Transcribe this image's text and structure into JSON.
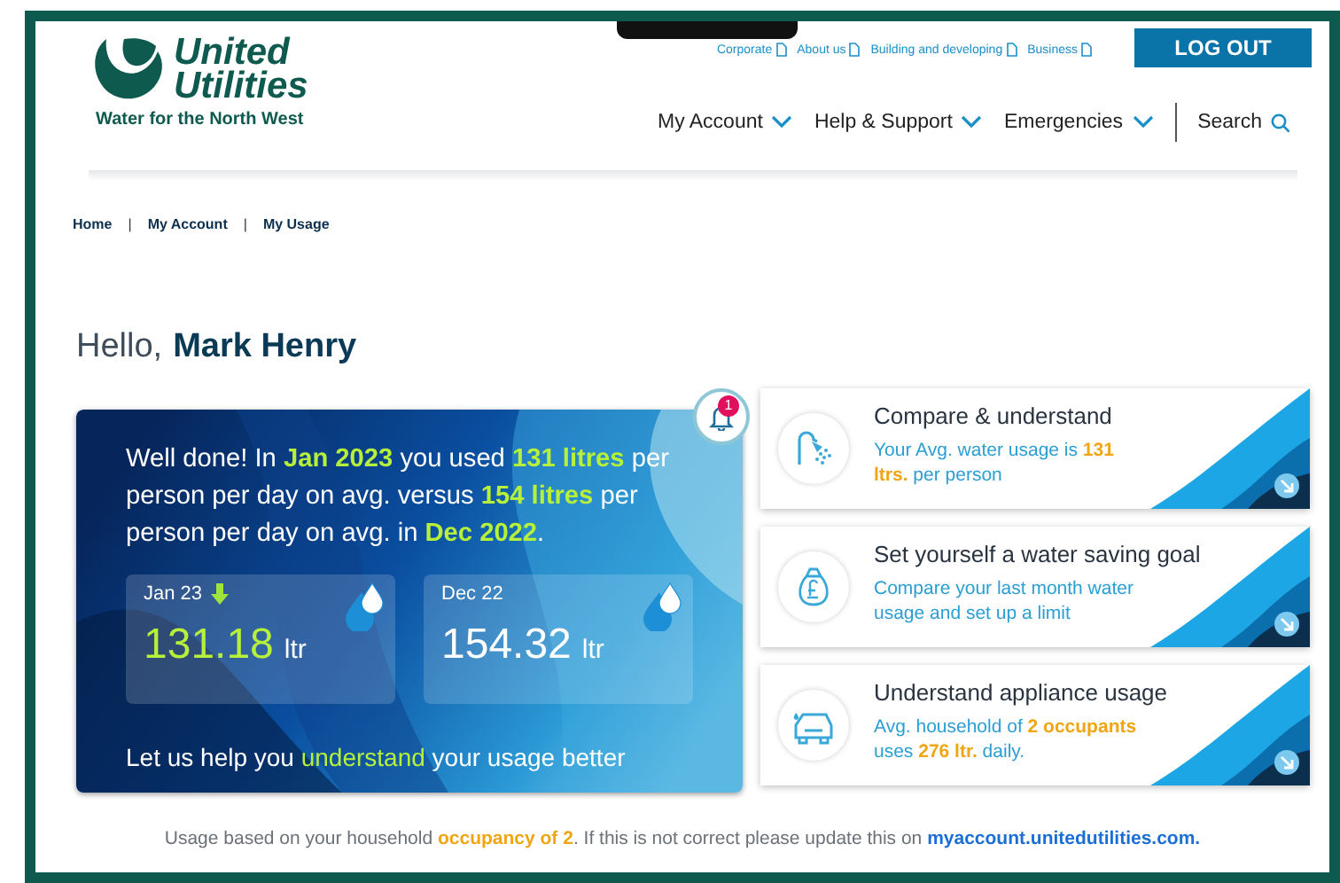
{
  "header": {
    "logo_name": "United Utilities",
    "tagline": "Water for the North West",
    "top_links": [
      "Corporate",
      "About us",
      "Building and developing",
      "Business"
    ],
    "logout": "LOG OUT",
    "nav": [
      {
        "label": "My Account",
        "kind": "dropdown"
      },
      {
        "label": "Help & Support",
        "kind": "dropdown"
      },
      {
        "label": "Emergencies",
        "kind": "dropdown"
      },
      {
        "label": "Search",
        "kind": "search"
      }
    ]
  },
  "breadcrumb": [
    {
      "label": "Home",
      "kind": "link"
    },
    {
      "label": "|",
      "kind": "separator"
    },
    {
      "label": "My Account",
      "kind": "link"
    },
    {
      "label": "|",
      "kind": "separator"
    },
    {
      "label": "My Usage",
      "kind": "link"
    }
  ],
  "greeting": {
    "prefix": "Hello,",
    "name": "Mark Henry"
  },
  "usage_card": {
    "summary": "Well done! In **Jan 2023** you used **131 litres** per person per day on avg. versus **154 litres** per person per day on avg. in **Dec 2022**.",
    "notifications": "1",
    "tiles": [
      {
        "label": "Jan 23",
        "kind": "decrease",
        "value": "131.18",
        "unit": "ltr",
        "highlight": true
      },
      {
        "label": "Dec 22",
        "kind": "plain",
        "value": "154.32",
        "unit": "ltr",
        "highlight": false
      }
    ],
    "footer": "Let us help you **understand** your usage better"
  },
  "cards": [
    {
      "kind": "shower",
      "title": "Compare & understand",
      "text": "Your Avg. water usage is **131 ltrs.** per person"
    },
    {
      "kind": "money-bag",
      "title": "Set yourself a water saving goal",
      "text": "Compare your last month water usage and set up a limit"
    },
    {
      "kind": "car",
      "title": "Understand appliance usage",
      "text": "Avg. household of **2 occupants** uses **276 ltr.** daily."
    }
  ],
  "note": {
    "text": "Usage based on your household **occupancy of 2**. If this is not correct please update this on",
    "link": "myaccount.unitedutilities.com."
  }
}
